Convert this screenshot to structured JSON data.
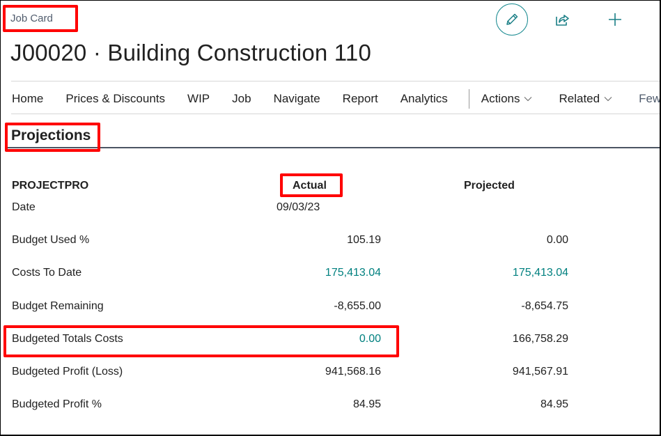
{
  "page": {
    "caption": "Job Card",
    "title": "J00020 · Building Construction 110"
  },
  "toolbar": {
    "edit_icon": "pencil-icon",
    "share_icon": "share-icon",
    "add_icon": "plus-icon"
  },
  "nav": {
    "items": [
      "Home",
      "Prices & Discounts",
      "WIP",
      "Job",
      "Navigate",
      "Report",
      "Analytics"
    ],
    "dropdowns": [
      "Actions",
      "Related"
    ],
    "fewer_label": "Fewer o"
  },
  "section": {
    "title": "Projections"
  },
  "projections": {
    "header_label": "PROJECTPRO",
    "col_actual": "Actual",
    "col_projected": "Projected",
    "date_label": "Date",
    "date_actual": "09/03/23",
    "rows": [
      {
        "label": "Budget Used %",
        "actual": "105.19",
        "projected": "0.00"
      },
      {
        "label": "Costs To Date",
        "actual": "175,413.04",
        "projected": "175,413.04"
      },
      {
        "label": "Budget Remaining",
        "actual": "-8,655.00",
        "projected": "-8,654.75"
      },
      {
        "label": "Budgeted Totals Costs",
        "actual": "0.00",
        "projected": "166,758.29"
      },
      {
        "label": "Budgeted Profit (Loss)",
        "actual": "941,568.16",
        "projected": "941,567.91"
      },
      {
        "label": "Budgeted Profit %",
        "actual": "84.95",
        "projected": "84.95"
      }
    ]
  },
  "colors": {
    "accent": "#00858a",
    "link": "#00807f",
    "highlight": "#ff0000"
  }
}
